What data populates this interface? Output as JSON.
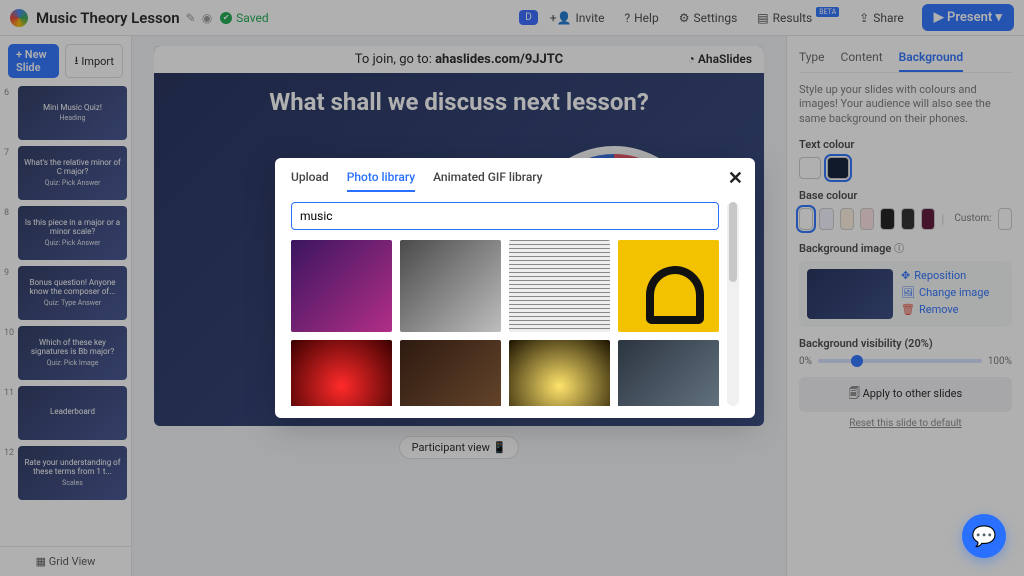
{
  "header": {
    "title": "Music Theory Lesson",
    "saved": "Saved",
    "do_badge": "D",
    "invite": "Invite",
    "help": "Help",
    "settings": "Settings",
    "results": "Results",
    "results_badge": "BETA",
    "share": "Share",
    "present": "Present"
  },
  "left": {
    "new_slide": "+ New Slide",
    "import": "Import",
    "grid_view": "Grid View",
    "thumbs": [
      {
        "n": "6",
        "title": "Mini Music Quiz!",
        "sub": "Heading"
      },
      {
        "n": "7",
        "title": "What's the relative minor of C major?",
        "sub": "Quiz: Pick Answer"
      },
      {
        "n": "8",
        "title": "Is this piece in a major or a minor scale?",
        "sub": "Quiz: Pick Answer"
      },
      {
        "n": "9",
        "title": "Bonus question! Anyone know the composer of...",
        "sub": "Quiz: Type Answer"
      },
      {
        "n": "10",
        "title": "Which of these key signatures is Bb major?",
        "sub": "Quiz: Pick Image"
      },
      {
        "n": "11",
        "title": "Leaderboard",
        "sub": ""
      },
      {
        "n": "12",
        "title": "Rate your understanding of these terms from 1 t...",
        "sub": "Scales"
      }
    ]
  },
  "canvas": {
    "join_prefix": "To join, go to: ",
    "join_bold": "ahaslides.com/9JJTC",
    "brand": "AhaSlides",
    "title": "What shall we discuss next lesson?",
    "participant_view": "Participant view"
  },
  "right": {
    "tabs": {
      "type": "Type",
      "content": "Content",
      "background": "Background"
    },
    "desc": "Style up your slides with colours and images! Your audience will also see the same background on their phones.",
    "text_colour": "Text colour",
    "base_colour": "Base colour",
    "custom": "Custom:",
    "bg_image": "Background image",
    "reposition": "Reposition",
    "change": "Change image",
    "remove": "Remove",
    "visibility_label": "Background visibility (20%)",
    "vis_min": "0%",
    "vis_max": "100%",
    "apply": "Apply to other slides",
    "reset": "Reset this slide to default",
    "text_swatches": [
      "#ffffff",
      "#0b1a33"
    ],
    "base_swatches": [
      "#ffffff",
      "#f3f5ff",
      "#fff2e0",
      "#ffe3e3",
      "#1a1a1a",
      "#292929",
      "#5a1133"
    ]
  },
  "modal": {
    "tabs": {
      "upload": "Upload",
      "photo": "Photo library",
      "gif": "Animated GIF library"
    },
    "search_value": "music"
  }
}
